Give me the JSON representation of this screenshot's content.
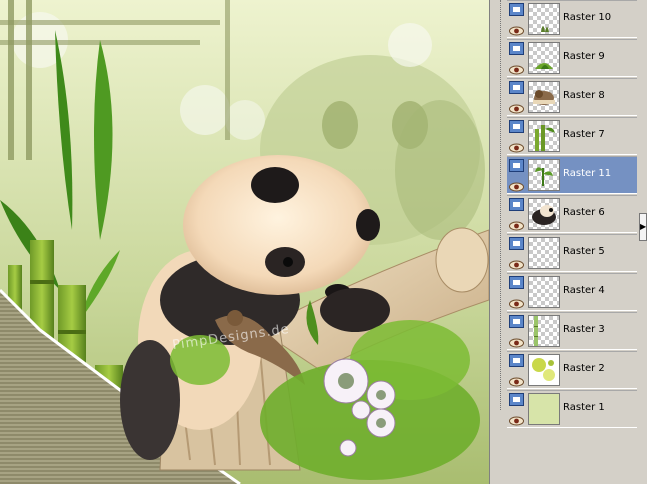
{
  "canvas": {
    "watermark_text": "PimpDesigns.de"
  },
  "layers_panel": {
    "layers": [
      {
        "name": "Raster 10",
        "selected": false,
        "thumb": "grass-tuft"
      },
      {
        "name": "Raster 9",
        "selected": false,
        "thumb": "green-plant"
      },
      {
        "name": "Raster 8",
        "selected": false,
        "thumb": "bird"
      },
      {
        "name": "Raster 7",
        "selected": false,
        "thumb": "bamboo"
      },
      {
        "name": "Raster 11",
        "selected": true,
        "thumb": "small-plant"
      },
      {
        "name": "Raster 6",
        "selected": false,
        "thumb": "panda"
      },
      {
        "name": "Raster 5",
        "selected": false,
        "thumb": "empty"
      },
      {
        "name": "Raster 4",
        "selected": false,
        "thumb": "empty"
      },
      {
        "name": "Raster 3",
        "selected": false,
        "thumb": "bamboo-stalk"
      },
      {
        "name": "Raster 2",
        "selected": false,
        "thumb": "flowers"
      },
      {
        "name": "Raster 1",
        "selected": false,
        "thumb": "solid-green"
      }
    ]
  },
  "colors": {
    "selected_row": "#7591c2",
    "panel_bg": "#d4d0c8",
    "canvas_bg": "#cfd9a4"
  }
}
